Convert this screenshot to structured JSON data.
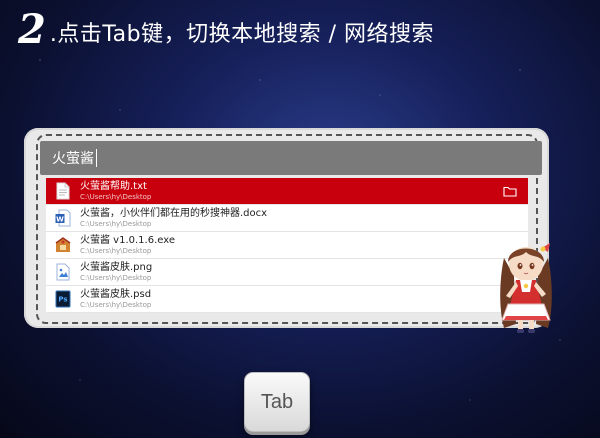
{
  "headline": {
    "step": "2",
    "text": ".点击Tab键，切换本地搜索 / 网络搜索"
  },
  "search": {
    "value": "火萤酱"
  },
  "results": [
    {
      "name": "火萤酱帮助.txt",
      "path": "C:\\Users\\hy\\Desktop",
      "icon": "text-file-icon",
      "selected": true
    },
    {
      "name": "火萤酱，小伙伴们都在用的秒搜神器.docx",
      "path": "C:\\Users\\hy\\Desktop",
      "icon": "word-file-icon",
      "selected": false
    },
    {
      "name": "火萤酱 v1.0.1.6.exe",
      "path": "C:\\Users\\hy\\Desktop",
      "icon": "installer-icon",
      "selected": false
    },
    {
      "name": "火萤酱皮肤.png",
      "path": "C:\\Users\\hy\\Desktop",
      "icon": "image-file-icon",
      "selected": false
    },
    {
      "name": "火萤酱皮肤.psd",
      "path": "C:\\Users\\hy\\Desktop",
      "icon": "photoshop-file-icon",
      "selected": false
    }
  ],
  "key": {
    "label": "Tab"
  },
  "colors": {
    "selected_row": "#c8000d",
    "search_bar": "#7a7a7a",
    "background": "#16205a"
  }
}
